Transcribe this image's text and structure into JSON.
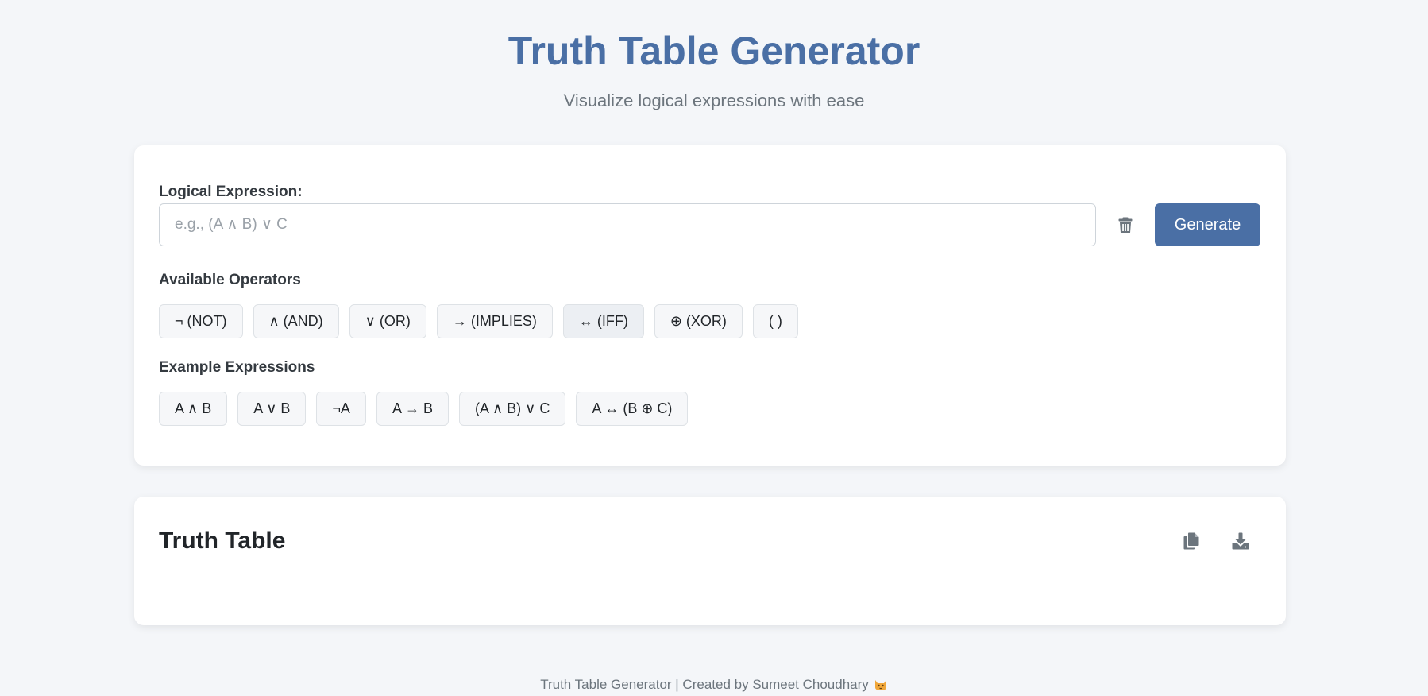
{
  "header": {
    "title": "Truth Table Generator",
    "subtitle": "Visualize logical expressions with ease"
  },
  "input_section": {
    "label": "Logical Expression:",
    "input_value": "",
    "input_placeholder": "e.g., (A ∧ B) ∨ C",
    "clear_icon": "trash-icon",
    "generate_label": "Generate"
  },
  "operators": {
    "heading": "Available Operators",
    "items": [
      "¬ (NOT)",
      "∧ (AND)",
      "∨ (OR)",
      "→ (IMPLIES)",
      "↔ (IFF)",
      "⊕ (XOR)",
      "( )"
    ],
    "highlighted_index": 4
  },
  "examples": {
    "heading": "Example Expressions",
    "items": [
      "A ∧ B",
      "A ∨ B",
      "¬A",
      "A → B",
      "(A ∧ B) ∨ C",
      "A ↔ (B ⊕ C)"
    ]
  },
  "truth_table": {
    "title": "Truth Table",
    "copy_icon": "copy-icon",
    "download_icon": "download-icon"
  },
  "footer": {
    "text": "Truth Table Generator | Created by Sumeet Choudhary",
    "emoji_icon": "cat-icon"
  },
  "colors": {
    "accent": "#4a6fa5",
    "background": "#f4f6f9",
    "card": "#ffffff",
    "muted_text": "#6c757d",
    "icon_gray": "#6c757d"
  }
}
